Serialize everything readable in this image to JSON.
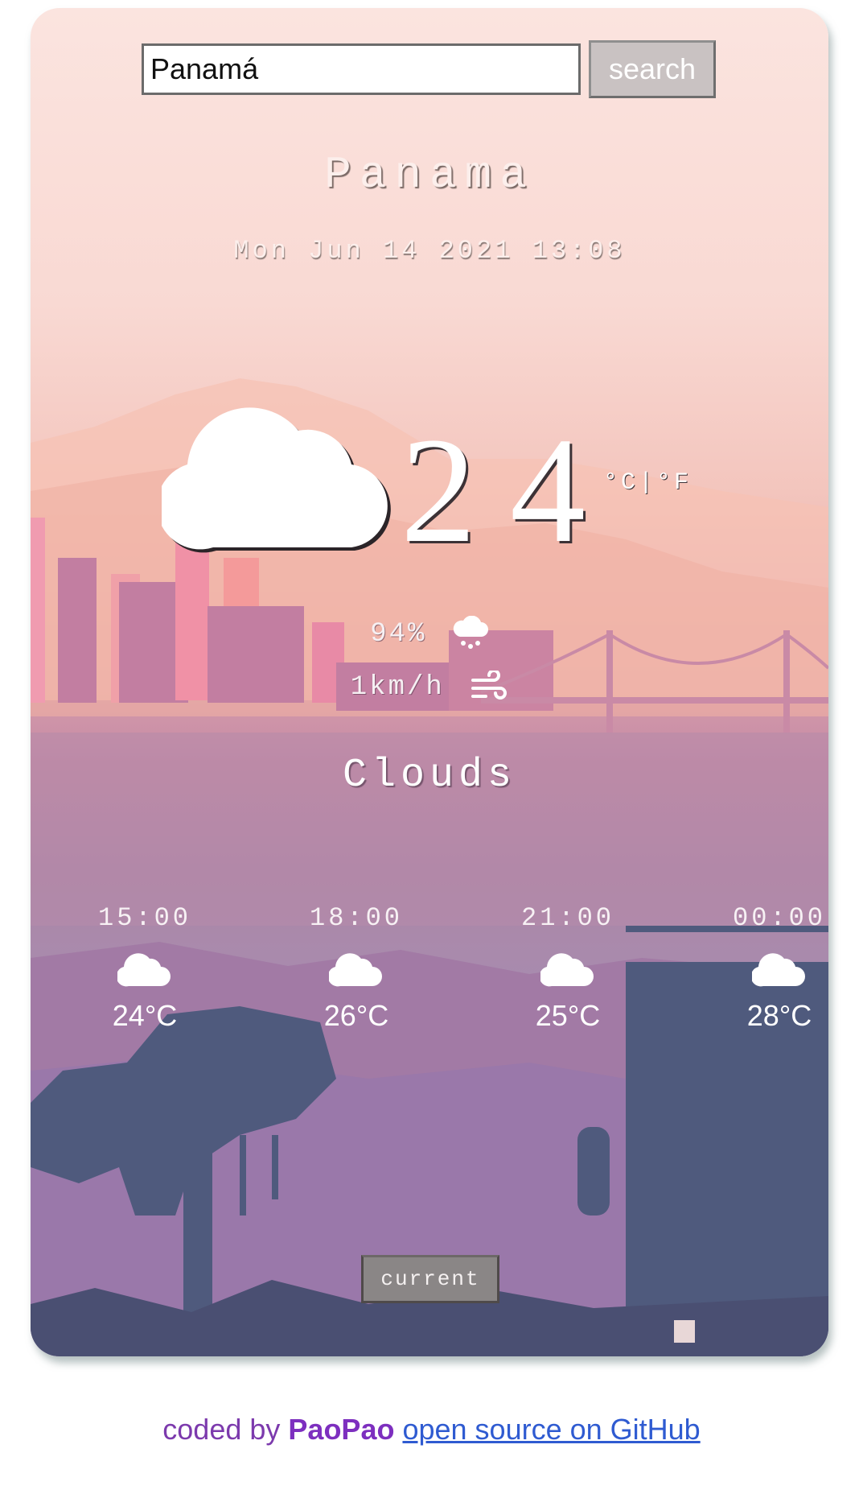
{
  "search": {
    "value": "Panamá",
    "button_label": "search"
  },
  "location": {
    "city": "Panama",
    "datetime": "Mon Jun 14 2021 13:08"
  },
  "current": {
    "temperature": "24",
    "units_label": "°C|°F",
    "humidity": "94%",
    "wind": "1km/h",
    "condition": "Clouds",
    "icon": "cloud-icon"
  },
  "forecast": [
    {
      "time": "15:00",
      "temp": "24°C",
      "icon": "cloud-icon"
    },
    {
      "time": "18:00",
      "temp": "26°C",
      "icon": "cloud-icon"
    },
    {
      "time": "21:00",
      "temp": "25°C",
      "icon": "cloud-icon"
    },
    {
      "time": "00:00",
      "temp": "28°C",
      "icon": "cloud-icon"
    }
  ],
  "controls": {
    "current_label": "current"
  },
  "footer": {
    "prefix": "coded by",
    "author": "PaoPao",
    "link_text": "open source on GitHub"
  },
  "colors": {
    "footer_text": "#7c3aad",
    "link": "#2f5bd1",
    "search_button": "#c9c2c2",
    "current_button": "#8a8686"
  }
}
